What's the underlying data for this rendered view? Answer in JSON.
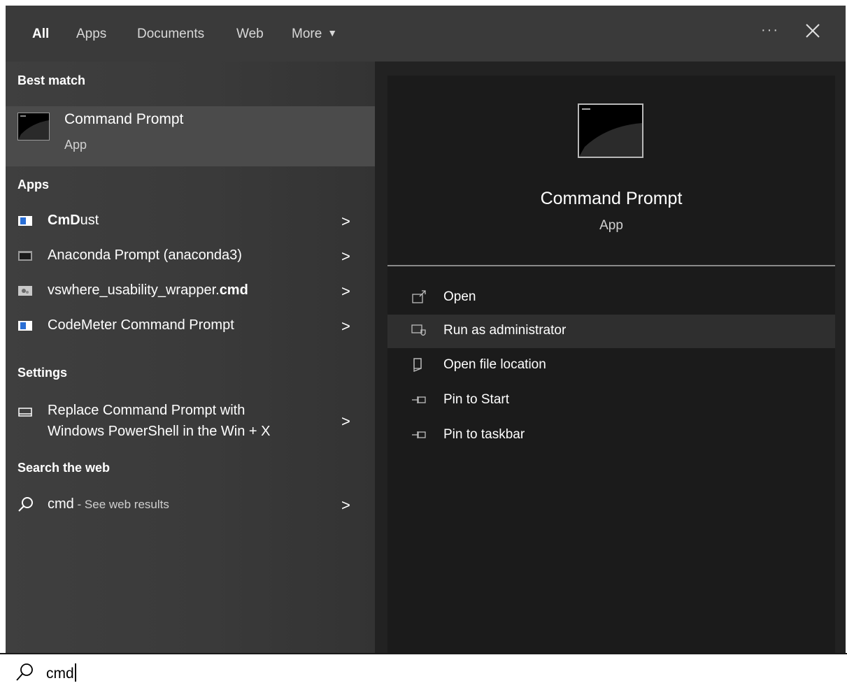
{
  "tabs": [
    {
      "label": "All",
      "active": true
    },
    {
      "label": "Apps"
    },
    {
      "label": "Documents"
    },
    {
      "label": "Web"
    },
    {
      "label": "More"
    }
  ],
  "window_controls": {
    "more_options": "···"
  },
  "best_match": {
    "heading": "Best match",
    "title": "Command Prompt",
    "subtitle": "App"
  },
  "apps": {
    "heading": "Apps",
    "items": [
      {
        "bold": "CmD",
        "rest": "ust"
      },
      {
        "bold": "",
        "rest": "Anaconda Prompt (anaconda3)"
      },
      {
        "bold": "cmd",
        "rest": "vswhere_usability_wrapper."
      },
      {
        "bold": "",
        "rest": "CodeMeter Command Prompt"
      }
    ]
  },
  "settings": {
    "heading": "Settings",
    "line1": "Replace Command Prompt with",
    "line2": "Windows PowerShell in the Win + X"
  },
  "web": {
    "heading": "Search the web",
    "query": "cmd",
    "suffix": " - See web results"
  },
  "details": {
    "title": "Command Prompt",
    "subtitle": "App",
    "actions": [
      "Open",
      "Run as administrator",
      "Open file location",
      "Pin to Start",
      "Pin to taskbar"
    ]
  },
  "search": {
    "value": "cmd"
  },
  "colors": {
    "panel": "#2c2c2c",
    "highlight": "#4b4b4b",
    "detail_panel": "#1b1b1b"
  }
}
